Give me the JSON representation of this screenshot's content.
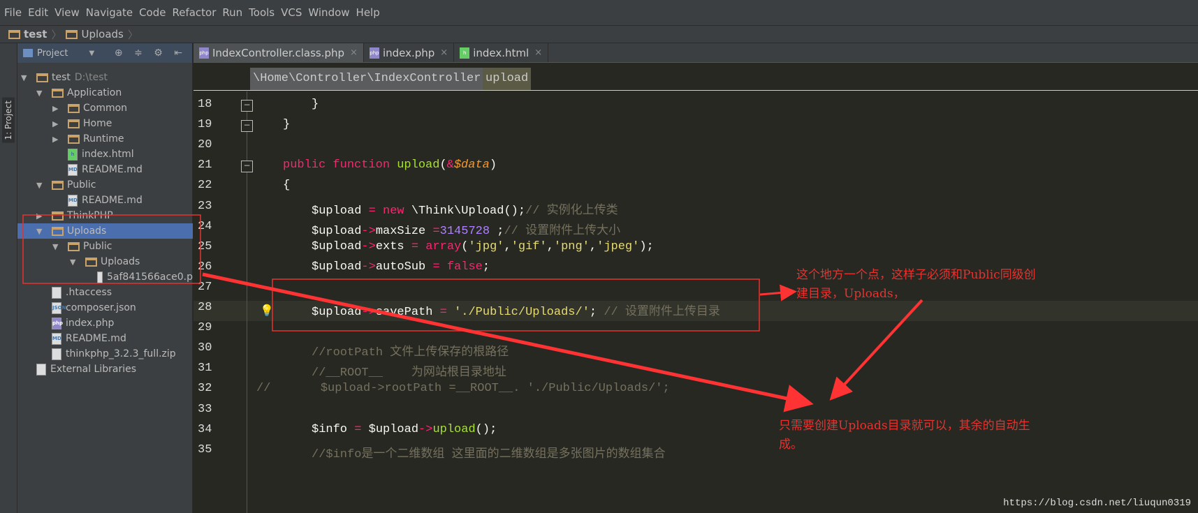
{
  "menu": [
    "File",
    "Edit",
    "View",
    "Navigate",
    "Code",
    "Refactor",
    "Run",
    "Tools",
    "VCS",
    "Window",
    "Help"
  ],
  "nav": {
    "project": "test",
    "folder": "Uploads"
  },
  "toolstrip": {
    "label": "1: Project"
  },
  "panel": {
    "title": "Project",
    "tools": "⊕ ≑ ⚙ ⇤"
  },
  "tree": [
    {
      "label": "test",
      "extra": "D:\\test",
      "level": 0,
      "type": "folder",
      "open": true
    },
    {
      "label": "Application",
      "level": 1,
      "type": "folder",
      "open": true
    },
    {
      "label": "Common",
      "level": 2,
      "type": "folder",
      "open": false
    },
    {
      "label": "Home",
      "level": 2,
      "type": "folder",
      "open": false
    },
    {
      "label": "Runtime",
      "level": 2,
      "type": "folder",
      "open": false
    },
    {
      "label": "index.html",
      "level": 2,
      "type": "html"
    },
    {
      "label": "README.md",
      "level": 2,
      "type": "md"
    },
    {
      "label": "Public",
      "level": 1,
      "type": "folder",
      "open": true
    },
    {
      "label": "README.md",
      "level": 2,
      "type": "md"
    },
    {
      "label": "ThinkPHP",
      "level": 1,
      "type": "folder",
      "open": false
    },
    {
      "label": "Uploads",
      "level": 1,
      "type": "folder",
      "open": true,
      "selected": true
    },
    {
      "label": "Public",
      "level": 2,
      "type": "folder",
      "open": true
    },
    {
      "label": "Uploads",
      "level": 3,
      "type": "folder",
      "open": true
    },
    {
      "label": "5af841566ace0.p",
      "level": 4,
      "type": "image"
    },
    {
      "label": ".htaccess",
      "level": 1,
      "type": "file"
    },
    {
      "label": "composer.json",
      "level": 1,
      "type": "json"
    },
    {
      "label": "index.php",
      "level": 1,
      "type": "php"
    },
    {
      "label": "README.md",
      "level": 1,
      "type": "md"
    },
    {
      "label": "thinkphp_3.2.3_full.zip",
      "level": 1,
      "type": "zip"
    },
    {
      "label": "External Libraries",
      "level": 0,
      "type": "lib"
    }
  ],
  "tabs": [
    {
      "label": "IndexController.class.php",
      "icon": "php",
      "active": true
    },
    {
      "label": "index.php",
      "icon": "php"
    },
    {
      "label": "index.html",
      "icon": "html"
    }
  ],
  "breadcrumb": [
    "\\Home\\Controller\\IndexController",
    "upload"
  ],
  "code": [
    {
      "n": "18",
      "indent": 2,
      "t": [
        [
          "}",
          ""
        ]
      ]
    },
    {
      "n": "19",
      "indent": 1,
      "t": [
        [
          "}",
          ""
        ]
      ]
    },
    {
      "n": "20",
      "indent": 0,
      "t": []
    },
    {
      "n": "21",
      "indent": 1,
      "t": [
        [
          "public function ",
          "k"
        ],
        [
          "upload",
          "f"
        ],
        [
          "(",
          ""
        ],
        [
          "&",
          "k"
        ],
        [
          "$data",
          "v"
        ],
        [
          ")",
          ""
        ]
      ]
    },
    {
      "n": "22",
      "indent": 1,
      "t": [
        [
          "{",
          ""
        ]
      ]
    },
    {
      "n": "23",
      "indent": 2,
      "t": [
        [
          "$upload ",
          ""
        ],
        [
          "= new ",
          "k"
        ],
        [
          "\\Think\\Upload();",
          ""
        ],
        [
          "// 实例化上传类",
          "c"
        ]
      ]
    },
    {
      "n": "24",
      "indent": 2,
      "t": [
        [
          "$upload",
          ""
        ],
        [
          "->",
          "k"
        ],
        [
          "maxSize ",
          ""
        ],
        [
          "=",
          "k"
        ],
        [
          "3145728",
          "n"
        ],
        [
          " ;",
          ""
        ],
        [
          "// 设置附件上传大小",
          "c"
        ]
      ]
    },
    {
      "n": "25",
      "indent": 2,
      "t": [
        [
          "$upload",
          ""
        ],
        [
          "->",
          "k"
        ],
        [
          "exts ",
          ""
        ],
        [
          "= array",
          "k"
        ],
        [
          "(",
          ""
        ],
        [
          "'jpg'",
          "s"
        ],
        [
          ",",
          ""
        ],
        [
          "'gif'",
          "s"
        ],
        [
          ",",
          ""
        ],
        [
          "'png'",
          "s"
        ],
        [
          ",",
          ""
        ],
        [
          "'jpeg'",
          "s"
        ],
        [
          ");",
          ""
        ]
      ]
    },
    {
      "n": "26",
      "indent": 2,
      "t": [
        [
          "$upload",
          ""
        ],
        [
          "->",
          "k"
        ],
        [
          "autoSub ",
          ""
        ],
        [
          "= false",
          "k"
        ],
        [
          ";",
          ""
        ]
      ]
    },
    {
      "n": "27",
      "indent": 0,
      "t": []
    },
    {
      "n": "28",
      "indent": 2,
      "t": [
        [
          "$upload",
          ""
        ],
        [
          "->",
          "k"
        ],
        [
          "savePath ",
          ""
        ],
        [
          "= ",
          "k"
        ],
        [
          "'./Public/Uploads/'",
          "s"
        ],
        [
          "; ",
          ""
        ],
        [
          "// 设置附件上传目录",
          "c"
        ]
      ]
    },
    {
      "n": "29",
      "indent": 0,
      "t": []
    },
    {
      "n": "30",
      "indent": 2,
      "t": [
        [
          "//rootPath 文件上传保存的根路径",
          "c"
        ]
      ]
    },
    {
      "n": "31",
      "indent": 2,
      "t": [
        [
          "//__ROOT__    为网站根目录地址",
          "c"
        ]
      ]
    },
    {
      "n": "32",
      "indent": 0,
      "t": [
        [
          "//       $upload->rootPath =__ROOT__. './Public/Uploads/';",
          "c"
        ]
      ]
    },
    {
      "n": "33",
      "indent": 0,
      "t": []
    },
    {
      "n": "34",
      "indent": 2,
      "t": [
        [
          "$info ",
          ""
        ],
        [
          "= ",
          "k"
        ],
        [
          "$upload",
          ""
        ],
        [
          "->",
          "k"
        ],
        [
          "upload",
          "f"
        ],
        [
          "();",
          ""
        ]
      ]
    },
    {
      "n": "35",
      "indent": 2,
      "t": [
        [
          "//$info是一个二维数组 这里面的二维数组是多张图片的数组集合",
          "c"
        ]
      ]
    }
  ],
  "annotations": {
    "note1": [
      "这个地方一个点，这样子必须和Public同级创",
      "建目录，Uploads，"
    ],
    "note2": [
      "只需要创建Uploads目录就可以，其余的自动生",
      "成。"
    ],
    "color": "#e8322f"
  },
  "watermark": "https://blog.csdn.net/liuqun0319"
}
